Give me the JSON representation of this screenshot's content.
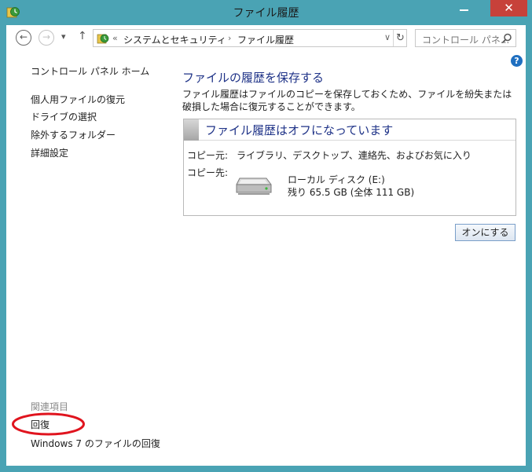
{
  "window": {
    "title": "ファイル履歴",
    "close_label": "✕"
  },
  "nav": {
    "back_glyph": "←",
    "forward_glyph": "→",
    "recent_glyph": "▾",
    "up_glyph": "↑"
  },
  "address": {
    "overflow": "«",
    "crumb_1": "システムとセキュリティ",
    "separator": "›",
    "crumb_2": "ファイル履歴",
    "dropdown_glyph": "∨",
    "refresh_glyph": "↻"
  },
  "search": {
    "placeholder": "コントロール パネ..."
  },
  "help": {
    "label": "?"
  },
  "sidebar": {
    "home": "コントロール パネル ホーム",
    "items": [
      {
        "label": "個人用ファイルの復元"
      },
      {
        "label": "ドライブの選択"
      },
      {
        "label": "除外するフォルダー"
      },
      {
        "label": "詳細設定"
      }
    ],
    "related_header": "関連項目",
    "related_items": [
      {
        "label": "回復"
      },
      {
        "label": "Windows 7 のファイルの回復"
      }
    ]
  },
  "main": {
    "title": "ファイルの履歴を保存する",
    "description": "ファイル履歴はファイルのコピーを保存しておくため、ファイルを紛失または破損した場合に復元することができます。",
    "status_title": "ファイル履歴はオフになっています",
    "copy_source_label": "コピー元:",
    "copy_source_value": "ライブラリ、デスクトップ、連絡先、およびお気に入り",
    "copy_dest_label": "コピー先:",
    "drive_name": "ローカル ディスク (E:)",
    "drive_free": "残り 65.5 GB (全体 111 GB)",
    "turn_on_button": "オンにする"
  },
  "colors": {
    "titlebar": "#4aa3b4",
    "close_button": "#c7413a",
    "heading_blue": "#1e3287",
    "annotation_red": "#e0141e"
  },
  "icons": {
    "app": "file-history-icon",
    "search": "search-icon",
    "drive": "hard-drive-icon",
    "help": "help-icon"
  }
}
